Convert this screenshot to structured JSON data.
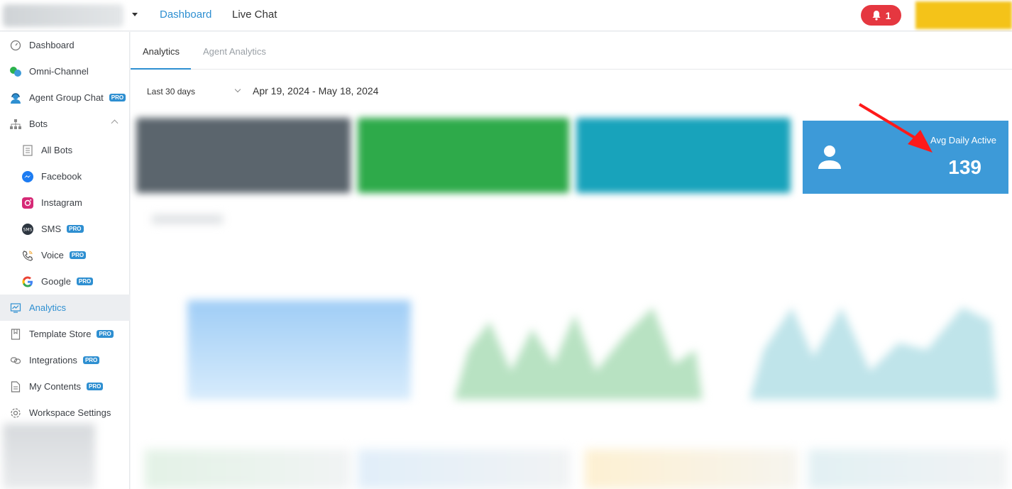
{
  "header": {
    "nav": [
      {
        "label": "Dashboard",
        "active": true
      },
      {
        "label": "Live Chat",
        "active": false
      }
    ],
    "notification_count": "1",
    "accent_color": "#2e8fd1",
    "badge_color": "#e53740"
  },
  "sidebar": {
    "items": [
      {
        "label": "Dashboard",
        "icon": "gauge-icon"
      },
      {
        "label": "Omni-Channel",
        "icon": "chat-bubbles-icon"
      },
      {
        "label": "Agent Group Chat",
        "icon": "headset-agent-icon",
        "pro": "PRO"
      },
      {
        "label": "Bots",
        "icon": "org-chart-icon"
      },
      {
        "label": "All Bots",
        "icon": "document-list-icon"
      },
      {
        "label": "Facebook",
        "icon": "messenger-icon"
      },
      {
        "label": "Instagram",
        "icon": "instagram-icon"
      },
      {
        "label": "SMS",
        "icon": "sms-icon",
        "pro": "PRO"
      },
      {
        "label": "Voice",
        "icon": "phone-icon",
        "pro": "PRO"
      },
      {
        "label": "Google",
        "icon": "google-icon",
        "pro": "PRO"
      },
      {
        "label": "Analytics",
        "icon": "analytics-icon",
        "active": true
      },
      {
        "label": "Template Store",
        "icon": "bookmark-icon",
        "pro": "PRO"
      },
      {
        "label": "Integrations",
        "icon": "link-icon",
        "pro": "PRO"
      },
      {
        "label": "My Contents",
        "icon": "file-icon",
        "pro": "PRO"
      },
      {
        "label": "Workspace Settings",
        "icon": "gear-icon"
      }
    ]
  },
  "tabs": [
    {
      "label": "Analytics",
      "active": true
    },
    {
      "label": "Agent Analytics",
      "active": false
    }
  ],
  "filter": {
    "range": "Last 30 days",
    "dates": "Apr 19, 2024 - May 18, 2024"
  },
  "kpi": {
    "label": "Avg Daily Active",
    "value": "139",
    "color": "#3d9ad8"
  }
}
